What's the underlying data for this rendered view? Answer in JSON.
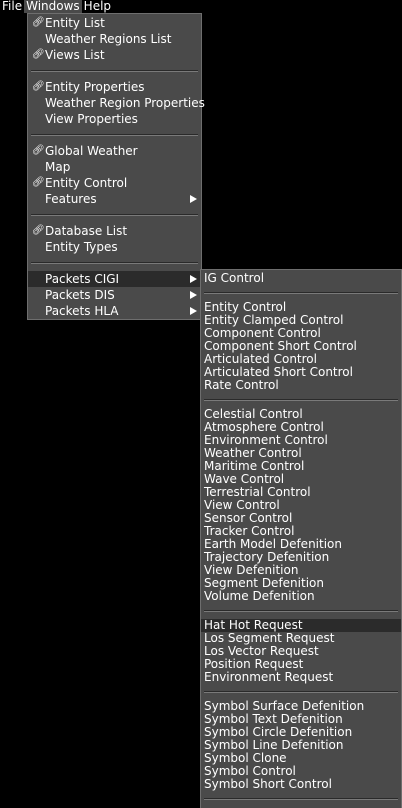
{
  "menubar": {
    "file": "File",
    "windows": "Windows",
    "help": "Help"
  },
  "windows_menu": {
    "entity_list": "Entity List",
    "weather_regions_list": "Weather Regions List",
    "views_list": "Views List",
    "entity_properties": "Entity Properties",
    "weather_region_properties": "Weather Region Properties",
    "view_properties": "View Properties",
    "global_weather": "Global Weather",
    "map": "Map",
    "entity_control": "Entity Control",
    "features": "Features",
    "database_list": "Database List",
    "entity_types": "Entity Types",
    "packets_cigi": "Packets CIGI",
    "packets_dis": "Packets DIS",
    "packets_hla": "Packets HLA"
  },
  "cigi_menu": {
    "ig_control": "IG Control",
    "entity_control": "Entity Control",
    "entity_clamped_control": "Entity Clamped Control",
    "component_control": "Component Control",
    "component_short_control": "Component Short Control",
    "articulated_control": "Articulated Control",
    "articulated_short_control": "Articulated Short Control",
    "rate_control": "Rate Control",
    "celestial_control": "Celestial Control",
    "atmosphere_control": "Atmosphere Control",
    "environment_control": "Environment Control",
    "weather_control": "Weather Control",
    "maritime_control": "Maritime Control",
    "wave_control": "Wave Control",
    "terrestrial_control": "Terrestrial Control",
    "view_control": "View Control",
    "sensor_control": "Sensor Control",
    "tracker_control": "Tracker Control",
    "earth_model_defenition": "Earth Model Defenition",
    "trajectory_defenition": "Trajectory Defenition",
    "view_defenition": "View Defenition",
    "segment_defenition": "Segment Defenition",
    "volume_defenition": "Volume Defenition",
    "hat_hot_request": "Hat Hot Request",
    "los_segment_request": "Los Segment Request",
    "los_vector_request": "Los Vector Request",
    "position_request": "Position Request",
    "environment_request": "Environment Request",
    "symbol_surface_defenition": "Symbol Surface Defenition",
    "symbol_text_defenition": "Symbol Text Defenition",
    "symbol_circle_defenition": "Symbol Circle Defenition",
    "symbol_line_defenition": "Symbol Line Defenition",
    "symbol_clone": "Symbol Clone",
    "symbol_control": "Symbol Control",
    "symbol_short_control": "Symbol Short Control"
  },
  "icons": {
    "item_icon": "link-icon",
    "submenu_arrow": "chevron-right-icon"
  },
  "colors": {
    "background": "#000000",
    "menu_bg": "#4a4a4a",
    "highlight": "#2b2b2b",
    "text": "#ffffff"
  }
}
